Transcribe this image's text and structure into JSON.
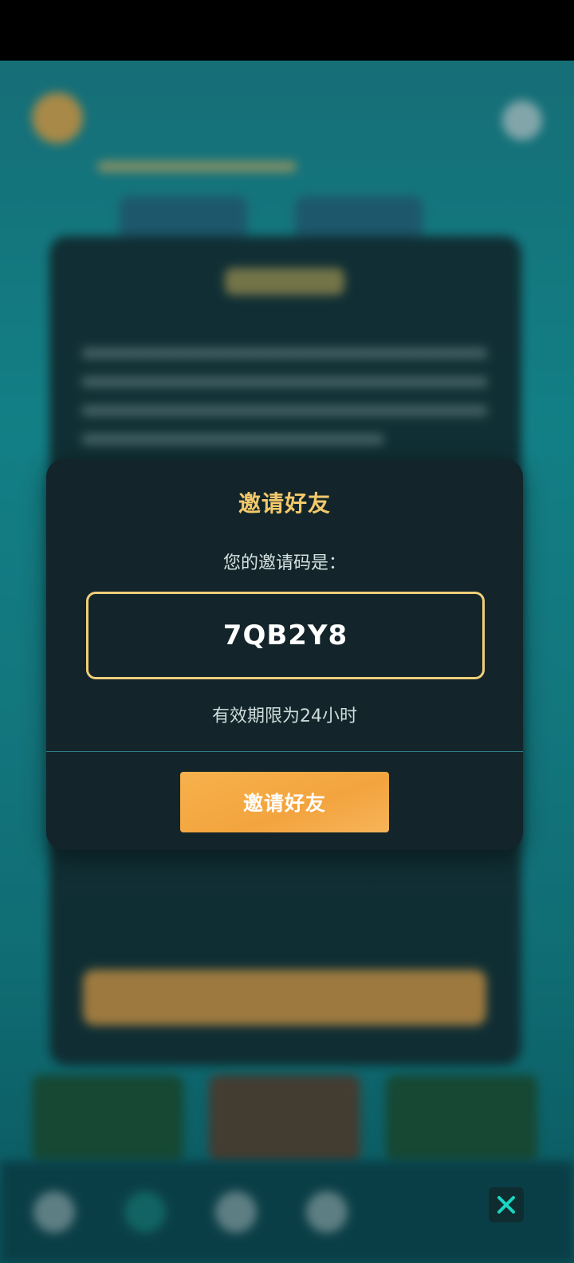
{
  "modal": {
    "title": "邀请好友",
    "code_label": "您的邀请码是：",
    "invite_code": "7QB2Y8",
    "validity_text": "有效期限为24小时",
    "invite_button_label": "邀请好友"
  },
  "icons": {
    "close": "close-icon"
  },
  "colors": {
    "title": "#f3c96a",
    "code_border": "#f0cf7a",
    "button": "#f3a43e",
    "modal_bg": "#13252a"
  }
}
